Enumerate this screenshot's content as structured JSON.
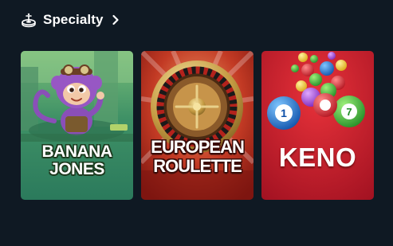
{
  "section": {
    "icon": "roulette-table-icon",
    "title": "Specialty",
    "more_icon": "chevron-right-icon"
  },
  "games": [
    {
      "id": "banana-jones",
      "title_lines": [
        "BANANA",
        "JONES"
      ],
      "colors": {
        "bg": "#2f7a5a",
        "accent": "#8a4fb8"
      }
    },
    {
      "id": "european-roulette",
      "title_lines": [
        "EUROPEAN",
        "ROULETTE"
      ],
      "colors": {
        "bg": "#a5241a",
        "accent": "#c9a24a"
      }
    },
    {
      "id": "keno",
      "title_lines": [
        "KENO"
      ],
      "colors": {
        "bg": "#c01e28",
        "accent": "#1d6fc4"
      }
    }
  ]
}
